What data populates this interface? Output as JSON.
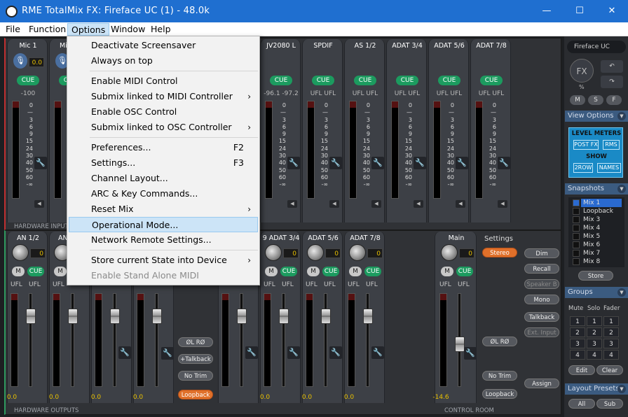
{
  "window": {
    "title": "RME TotalMix FX: Fireface UC (1) - 48.0k",
    "minimize": "—",
    "maximize": "☐",
    "close": "✕"
  },
  "menu": {
    "items": [
      "File",
      "Function",
      "Options",
      "Window",
      "Help"
    ]
  },
  "options_menu": {
    "items": [
      {
        "label": "Deactivate Screensaver",
        "shortcut": "",
        "submenu": false,
        "disabled": false
      },
      {
        "label": "Always on top",
        "shortcut": "",
        "submenu": false,
        "disabled": false
      },
      {
        "label": "Enable MIDI Control",
        "shortcut": "",
        "submenu": false,
        "disabled": false
      },
      {
        "label": "Submix linked to MIDI Controller",
        "shortcut": "",
        "submenu": true,
        "disabled": false
      },
      {
        "label": "Enable OSC Control",
        "shortcut": "",
        "submenu": false,
        "disabled": false
      },
      {
        "label": "Submix linked to OSC Controller",
        "shortcut": "",
        "submenu": true,
        "disabled": false
      },
      {
        "label": "Preferences...",
        "shortcut": "F2",
        "submenu": false,
        "disabled": false
      },
      {
        "label": "Settings...",
        "shortcut": "F3",
        "submenu": false,
        "disabled": false
      },
      {
        "label": "Channel Layout...",
        "shortcut": "",
        "submenu": false,
        "disabled": false
      },
      {
        "label": "ARC & Key Commands...",
        "shortcut": "",
        "submenu": false,
        "disabled": false
      },
      {
        "label": "Reset Mix",
        "shortcut": "",
        "submenu": true,
        "disabled": false
      },
      {
        "label": "Operational Mode...",
        "shortcut": "",
        "submenu": false,
        "disabled": false,
        "highlighted": true
      },
      {
        "label": "Network Remote Settings...",
        "shortcut": "",
        "submenu": false,
        "disabled": false
      },
      {
        "label": "Store current State into Device",
        "shortcut": "",
        "submenu": true,
        "disabled": false
      },
      {
        "label": "Enable Stand Alone MIDI",
        "shortcut": "",
        "submenu": false,
        "disabled": true
      }
    ]
  },
  "inputs": {
    "section_label": "HARDWARE INPUTS",
    "channels": [
      {
        "name": "Mic 1",
        "gain": "0.0",
        "level": "-100",
        "cue": "CUE"
      },
      {
        "name": "Mi",
        "gain": "",
        "level": "-1",
        "cue": "CUE"
      },
      {
        "name": "JV2080 L",
        "level": "-96.1 -97.2",
        "cue": "CUE"
      },
      {
        "name": "SPDIF",
        "level": "UFL UFL",
        "cue": "CUE"
      },
      {
        "name": "AS 1/2",
        "level": "UFL UFL",
        "cue": "CUE"
      },
      {
        "name": "ADAT 3/4",
        "level": "UFL UFL",
        "cue": "CUE"
      },
      {
        "name": "ADAT 5/6",
        "level": "UFL UFL",
        "cue": "CUE"
      },
      {
        "name": "ADAT 7/8",
        "level": "UFL UFL",
        "cue": "CUE"
      }
    ],
    "scale": [
      "OVR",
      "0",
      "3",
      "6",
      "9",
      "15",
      "24",
      "30",
      "40",
      "50",
      "60",
      "-∞"
    ]
  },
  "outputs": {
    "section_label": "HARDWARE OUTPUTS",
    "channels": [
      {
        "name": "AN 1/2",
        "gain": "0",
        "fader": "0.0"
      },
      {
        "name": "AN",
        "gain": "",
        "fader": "0.0"
      },
      {
        "name": "",
        "gain": "",
        "fader": "0.0"
      },
      {
        "name": "",
        "gain": "",
        "fader": "0.0"
      },
      {
        "name": "9 ADAT 3/4",
        "gain": "0",
        "fader": "0.0"
      },
      {
        "name": "ADAT 5/6",
        "gain": "0",
        "fader": "0.0"
      },
      {
        "name": "ADAT 7/8",
        "gain": "0",
        "fader": "0.0"
      }
    ],
    "m": "M",
    "cue": "CUE",
    "ufl": "UFL",
    "fader_zero": "0",
    "buttons": {
      "phase": "ØL RØ",
      "talkback": "+Talkback",
      "no_trim": "No Trim",
      "loopback": "Loopback"
    }
  },
  "control_room": {
    "section_label": "CONTROL ROOM",
    "main": {
      "name": "Main",
      "gain": "0",
      "fader": "-14.6",
      "level": "-14.6"
    },
    "settings_label": "Settings",
    "stereo": "Stereo",
    "buttons": {
      "dim": "Dim",
      "recall": "Recall",
      "speaker_b": "Speaker B",
      "mono": "Mono",
      "talkback": "Talkback",
      "ext_input": "Ext. Input",
      "assign": "Assign"
    },
    "phase": "ØL RØ",
    "no_trim": "No Trim",
    "loopback": "Loopback"
  },
  "right_panel": {
    "device": "Fireface UC",
    "fx": "FX",
    "fx_pct": "%",
    "msf": [
      "M",
      "S",
      "F"
    ],
    "view_options": "View Options",
    "level_meters": "LEVEL METERS",
    "post_fx": "POST FX",
    "rms": "RMS",
    "show": "SHOW",
    "two_row": "2ROW",
    "names": "NAMES",
    "snapshots": "Snapshots",
    "snapshot_items": [
      "Mix 1",
      "Loopback",
      "Mix 3",
      "Mix 4",
      "Mix 5",
      "Mix 6",
      "Mix 7",
      "Mix 8"
    ],
    "store": "Store",
    "groups": "Groups",
    "group_headers": [
      "Mute",
      "Solo",
      "Fader"
    ],
    "group_rows": [
      [
        "1",
        "1",
        "1"
      ],
      [
        "2",
        "2",
        "2"
      ],
      [
        "3",
        "3",
        "3"
      ],
      [
        "4",
        "4",
        "4"
      ]
    ],
    "edit": "Edit",
    "clear": "Clear",
    "layout_presets": "Layout Presets",
    "all": "All",
    "sub": "Sub"
  },
  "colors": {
    "cue_green": "#1c9b5f",
    "titlebar": "#1f6fd0",
    "orange": "#e0702a",
    "highlight": "#cce4f7"
  }
}
